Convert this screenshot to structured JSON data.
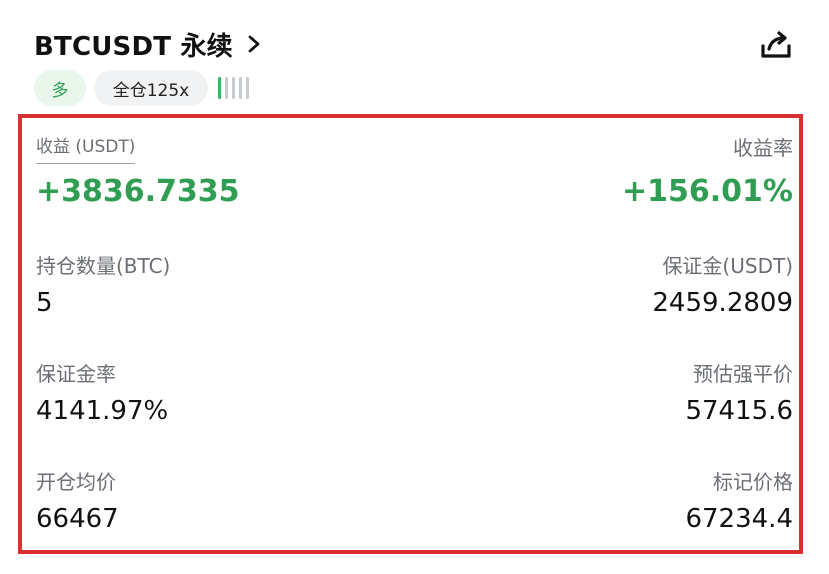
{
  "header": {
    "title": "BTCUSDT 永续"
  },
  "tags": {
    "side": "多",
    "margin_mode": "全仓125x",
    "risk_level_bars_total": 5,
    "risk_level_bars_active": 1
  },
  "colors": {
    "profit_green": "#2f9e52",
    "highlight_border": "#d92f2f",
    "long_tag_bg": "#e8f6ec"
  },
  "icons": {
    "chevron": "chevron-right-icon",
    "share": "share-icon"
  },
  "position": {
    "pnl_label": "收益 (USDT)",
    "pnl_value": "+3836.7335",
    "roe_label": "收益率",
    "roe_value": "+156.01%",
    "size_label": "持仓数量(BTC)",
    "size_value": "5",
    "margin_label": "保证金(USDT)",
    "margin_value": "2459.2809",
    "margin_ratio_label": "保证金率",
    "margin_ratio_value": "4141.97%",
    "liq_price_label": "预估强平价",
    "liq_price_value": "57415.6",
    "entry_price_label": "开仓均价",
    "entry_price_value": "66467",
    "mark_price_label": "标记价格",
    "mark_price_value": "67234.4"
  }
}
